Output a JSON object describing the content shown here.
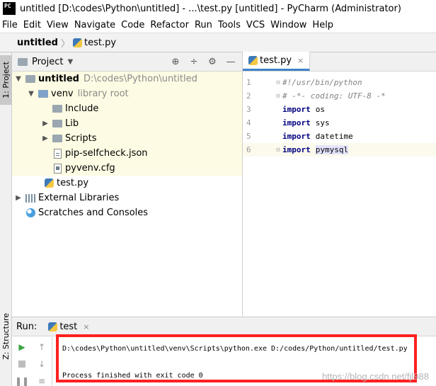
{
  "window": {
    "title": "untitled [D:\\codes\\Python\\untitled] - ...\\test.py [untitled] - PyCharm (Administrator)",
    "logo_text": "PC"
  },
  "menu": [
    "File",
    "Edit",
    "View",
    "Navigate",
    "Code",
    "Refactor",
    "Run",
    "Tools",
    "VCS",
    "Window",
    "Help"
  ],
  "navbar": {
    "project": "untitled",
    "separator": "〉",
    "file": "test.py"
  },
  "left_strip": {
    "project_tab": "1: Project",
    "structure_tab": "Z: Structure"
  },
  "project_panel": {
    "title": "Project",
    "caret": "▼",
    "tools": [
      "⊕",
      "÷",
      "⚙",
      "—"
    ],
    "tree": {
      "root": {
        "name": "untitled",
        "path": "D:\\codes\\Python\\untitled"
      },
      "venv": {
        "name": "venv",
        "note": "library root"
      },
      "venv_children": [
        "Include",
        "Lib",
        "Scripts",
        "pip-selfcheck.json",
        "pyvenv.cfg"
      ],
      "root_file": "test.py",
      "external": "External Libraries",
      "scratches": "Scratches and Consoles"
    }
  },
  "editor": {
    "tab": "test.py",
    "close": "×",
    "lines": [
      {
        "n": "1",
        "text": "#!/usr/bin/python"
      },
      {
        "n": "2",
        "text": "# -*- coding: UTF-8 -*"
      },
      {
        "n": "3",
        "kw": "import",
        "ident": "os"
      },
      {
        "n": "4",
        "kw": "import",
        "ident": "sys"
      },
      {
        "n": "5",
        "kw": "import",
        "ident": "datetime"
      },
      {
        "n": "6",
        "kw": "import",
        "ident": "pymysql"
      }
    ]
  },
  "run_panel": {
    "label": "Run:",
    "tab": "test",
    "close": "×",
    "console": {
      "command": "D:\\codes\\Python\\untitled\\venv\\Scripts\\python.exe D:/codes/Python/untitled/test.py",
      "blank": "",
      "exit": "Process finished with exit code 0"
    },
    "watermark": "https://blog.csdn.net/fjl988"
  },
  "colors": {
    "accent": "#4083c9",
    "highlight_box": "#ff2020",
    "run_green": "#3ea542"
  }
}
